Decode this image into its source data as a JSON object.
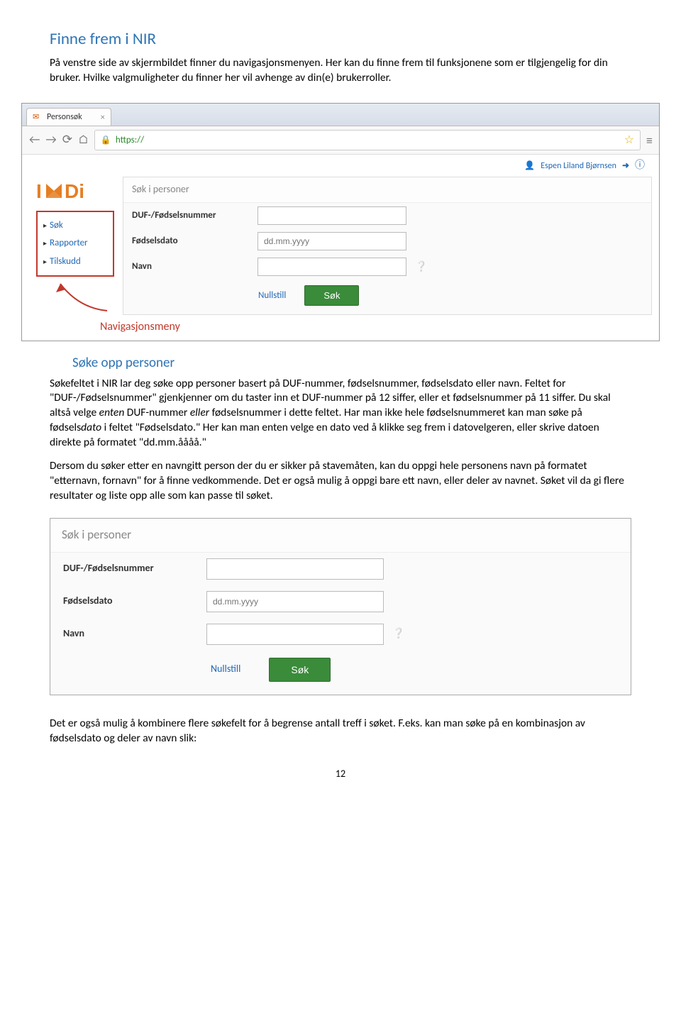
{
  "headings": {
    "h1": "Finne frem i NIR",
    "h2": "Søke opp personer"
  },
  "para": {
    "intro1": "På venstre side av skjermbildet finner du navigasjonsmenyen. Her kan du finne frem til funksjonene som er tilgjengelig for din bruker. Hvilke valgmuligheter du finner her vil avhenge av din(e) brukerroller.",
    "p2a": "Søkefeltet i NIR lar deg søke opp personer basert på DUF-nummer, fødselsnummer, fødselsdato eller navn. Feltet for \"DUF-/Fødselsnummer\" gjenkjenner om du taster inn et DUF-nummer på 12 siffer, eller et fødselsnummer på 11 siffer. Du skal altså velge ",
    "p2b": "enten",
    "p2c": " DUF-nummer ",
    "p2d": "eller",
    "p2e": " fødselsnummer i dette feltet. Har man ikke hele fødselsnummeret kan man søke på fødsels",
    "p2f": "dato",
    "p2g": " i feltet \"Fødselsdato.\" Her kan man enten velge en dato ved å klikke seg frem i datovelgeren, eller skrive datoen direkte på formatet \"dd.mm.åååå.\"",
    "p3": "Dersom du søker etter en navngitt person der du er sikker på stavemåten, kan du oppgi hele personens navn på formatet \"etternavn, fornavn\" for å finne vedkommende. Det er også mulig å oppgi bare ett navn, eller deler av navnet. Søket vil da gi flere resultater og liste opp alle som kan passe til søket.",
    "p4": "Det er også mulig å kombinere flere søkefelt for å begrense antall treff i søket. F.eks. kan man søke på en kombinasjon av fødselsdato og deler av navn slik:"
  },
  "browser": {
    "tab_title": "Personsøk",
    "url": "https://",
    "user": "Espen Liland Bjørnsen",
    "nav": [
      "Søk",
      "Rapporter",
      "Tilskudd"
    ],
    "nav_caption": "Navigasjonsmeny",
    "panel_header": "Søk i personer",
    "labels": {
      "duf": "DUF-/Fødselsnummer",
      "dato": "Fødselsdato",
      "navn": "Navn"
    },
    "placeholder_dato": "dd.mm.yyyy",
    "btn_reset": "Nullstill",
    "btn_search": "Søk"
  },
  "page_number": "12"
}
